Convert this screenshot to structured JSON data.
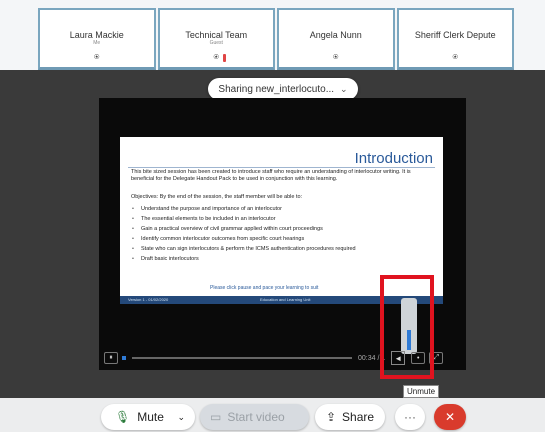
{
  "participants": [
    {
      "name": "Laura Mackie",
      "sub": "Me"
    },
    {
      "name": "Technical Team",
      "sub": "Guest"
    },
    {
      "name": "Angela Nunn",
      "sub": ""
    },
    {
      "name": "Sheriff Clerk Depute",
      "sub": ""
    }
  ],
  "sharing": {
    "label": "Sharing new_interlocuto...",
    "chevron": "chevron-down-icon"
  },
  "slide": {
    "title": "Introduction",
    "intro": "This bite sized session has been created to introduce staff who require an understanding of interlocutor writing. It is beneficial for the Delegate Handout Pack to be used in conjunction with this learning.",
    "objectives": "Objectives: By the end of the session, the staff member will be able to:",
    "bullets": [
      "Understand the purpose and importance of an interlocutor",
      "The essential elements to be included in an interlocutor",
      "Gain a practical overview of civil grammar applied within court proceedings",
      "Identify common interlocutor outcomes from specific court hearings",
      "State who can sign interlocutors & perform the ICMS authentication procedures required",
      "Draft basic interlocutors"
    ],
    "note": "Please click pause and pace your learning to suit",
    "footer_left": "Version 1 - 01/02/2020",
    "footer_center": "Education and Learning Unit"
  },
  "player": {
    "time": "00:34 / 1",
    "progress": 0.0
  },
  "tooltip": "Unmute",
  "controls": {
    "mute": "Mute",
    "video": "Start video",
    "share": "Share",
    "more": "···",
    "colors": {
      "leave": "#d93b2c",
      "mic": "#2a7a3a",
      "highlight": "#e0131f"
    }
  }
}
